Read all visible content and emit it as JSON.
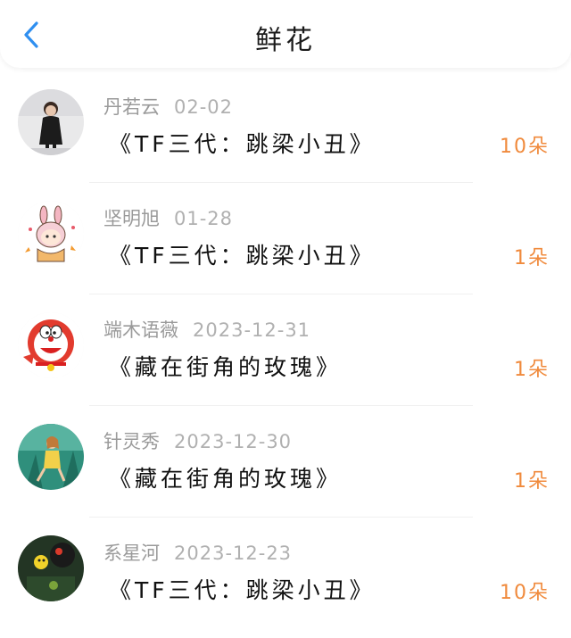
{
  "header": {
    "title": "鲜花",
    "back_icon": "chevron-left-icon",
    "accent": "#2f8ff0"
  },
  "count_color": "#f08a3c",
  "items": [
    {
      "name": "丹若云",
      "date": "02-02",
      "song": "《TF三代：跳梁小丑》",
      "count": "10朵",
      "avatar": "girl-dark-dress-photo"
    },
    {
      "name": "坚明旭",
      "date": "01-28",
      "song": "《TF三代：跳梁小丑》",
      "count": "1朵",
      "avatar": "cartoon-bunny-girl"
    },
    {
      "name": "端木语薇",
      "date": "2023-12-31",
      "song": "《藏在街角的玫瑰》",
      "count": "1朵",
      "avatar": "doraemon"
    },
    {
      "name": "针灵秀",
      "date": "2023-12-30",
      "song": "《藏在街角的玫瑰》",
      "count": "1朵",
      "avatar": "illustrated-girl-green"
    },
    {
      "name": "系星河",
      "date": "2023-12-23",
      "song": "《TF三代：跳梁小丑》",
      "count": "10朵",
      "avatar": "dark-photo-toys"
    }
  ]
}
